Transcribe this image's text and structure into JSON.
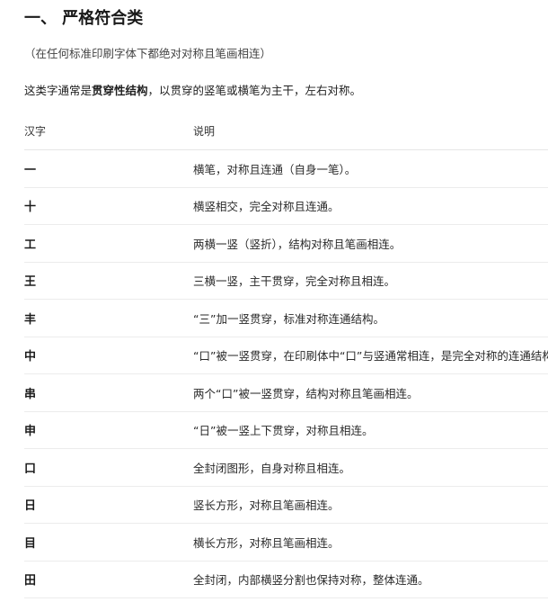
{
  "section": {
    "title": "一、 严格符合类",
    "note": "（在任何标准印刷字体下都绝对对称且笔画相连）",
    "intro_before": "这类字通常是",
    "intro_bold": "贯穿性结构",
    "intro_after": "，以贯穿的竖笔或横笔为主干，左右对称。"
  },
  "table": {
    "headers": [
      "汉字",
      "说明"
    ],
    "rows": [
      {
        "char": "一",
        "desc": "横笔，对称且连通（自身一笔）。"
      },
      {
        "char": "十",
        "desc": "横竖相交，完全对称且连通。"
      },
      {
        "char": "工",
        "desc": "两横一竖（竖折），结构对称且笔画相连。"
      },
      {
        "char": "王",
        "desc": "三横一竖，主干贯穿，完全对称且相连。"
      },
      {
        "char": "丰",
        "desc": "“三”加一竖贯穿，标准对称连通结构。"
      },
      {
        "char": "中",
        "desc": "“口”被一竖贯穿，在印刷体中“口”与竖通常相连，是完全对称的连通结构。"
      },
      {
        "char": "串",
        "desc": "两个“口”被一竖贯穿，结构对称且笔画相连。"
      },
      {
        "char": "申",
        "desc": "“日”被一竖上下贯穿，对称且相连。"
      },
      {
        "char": "口",
        "desc": "全封闭图形，自身对称且相连。"
      },
      {
        "char": "日",
        "desc": "竖长方形，对称且笔画相连。"
      },
      {
        "char": "目",
        "desc": "横长方形，对称且笔画相连。"
      },
      {
        "char": "田",
        "desc": "全封闭，内部横竖分割也保持对称，整体连通。"
      }
    ]
  }
}
